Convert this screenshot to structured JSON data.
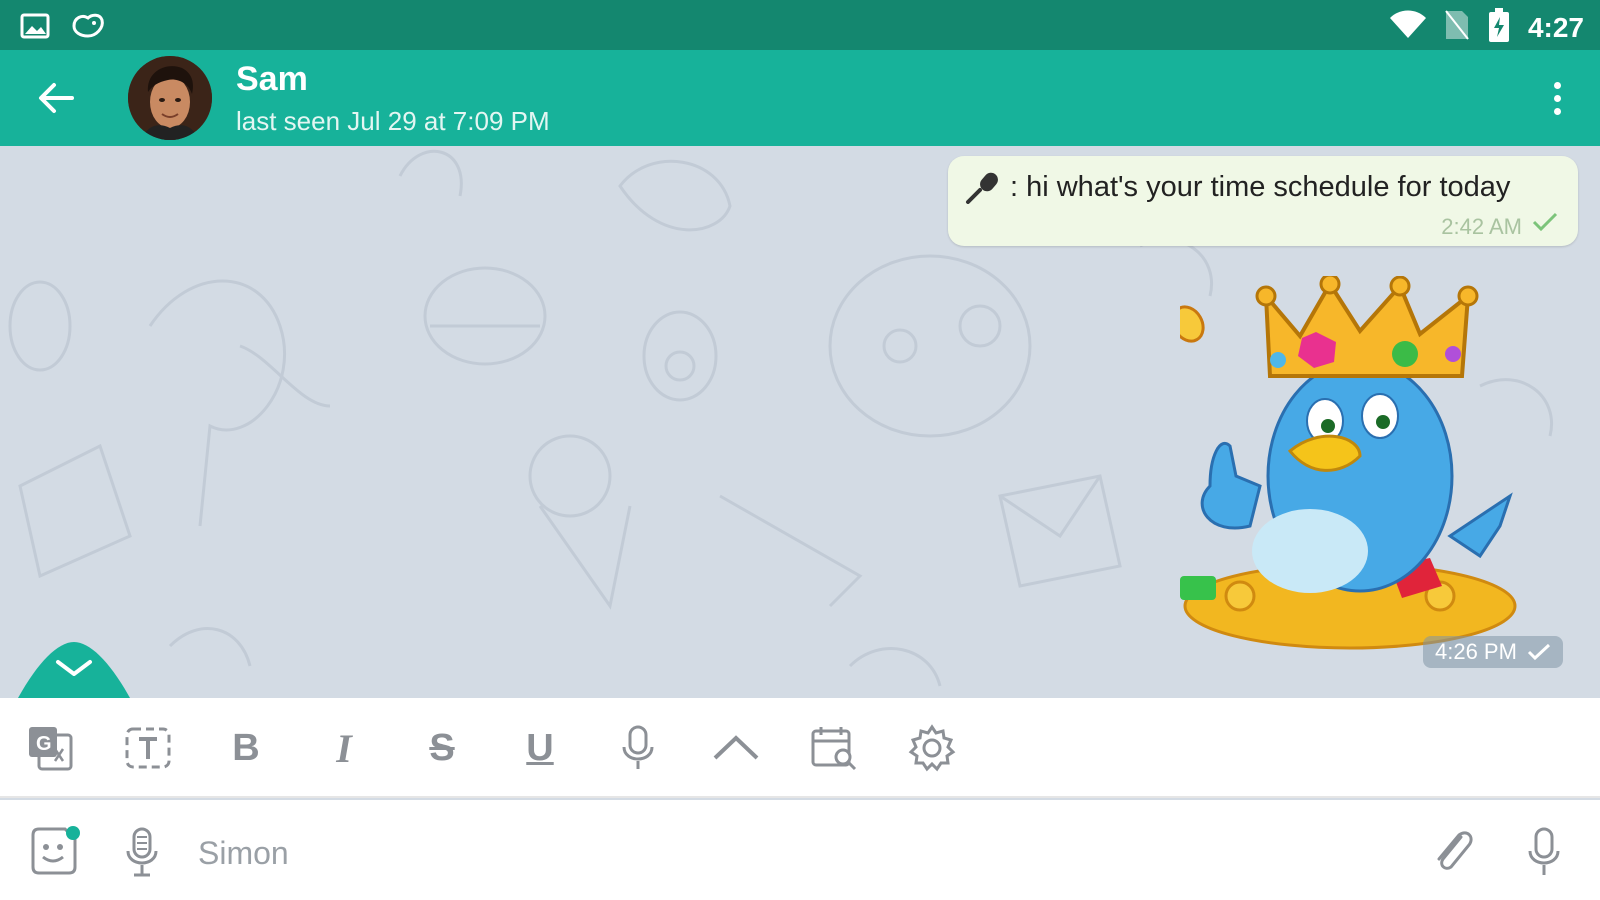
{
  "status_bar": {
    "time": "4:27",
    "left_icons": [
      "image-icon",
      "bird-icon"
    ],
    "right_icons": [
      "wifi-icon",
      "no-sim-icon",
      "battery-charging-icon"
    ]
  },
  "header": {
    "contact_name": "Sam",
    "contact_status": "last seen Jul 29 at 7:09 PM",
    "accent_color": "#17b29a"
  },
  "messages": [
    {
      "type": "text",
      "prefix_icon": "microphone-icon",
      "text": ": hi what's your time schedule for today",
      "time": "2:42 AM",
      "status": "sent"
    },
    {
      "type": "sticker",
      "sticker_name": "crowned-blue-bird-sticker",
      "time": "4:26 PM",
      "status": "sent"
    }
  ],
  "format_toolbar": {
    "buttons": [
      "translate",
      "text-box",
      "bold",
      "italic",
      "strikethrough",
      "underline",
      "microphone",
      "chevron-up",
      "calendar-search",
      "settings"
    ],
    "labels": {
      "bold": "B",
      "italic": "I",
      "strikethrough": "S",
      "underline": "U",
      "text_box": "T"
    }
  },
  "input": {
    "value": "",
    "placeholder": "Simon"
  }
}
